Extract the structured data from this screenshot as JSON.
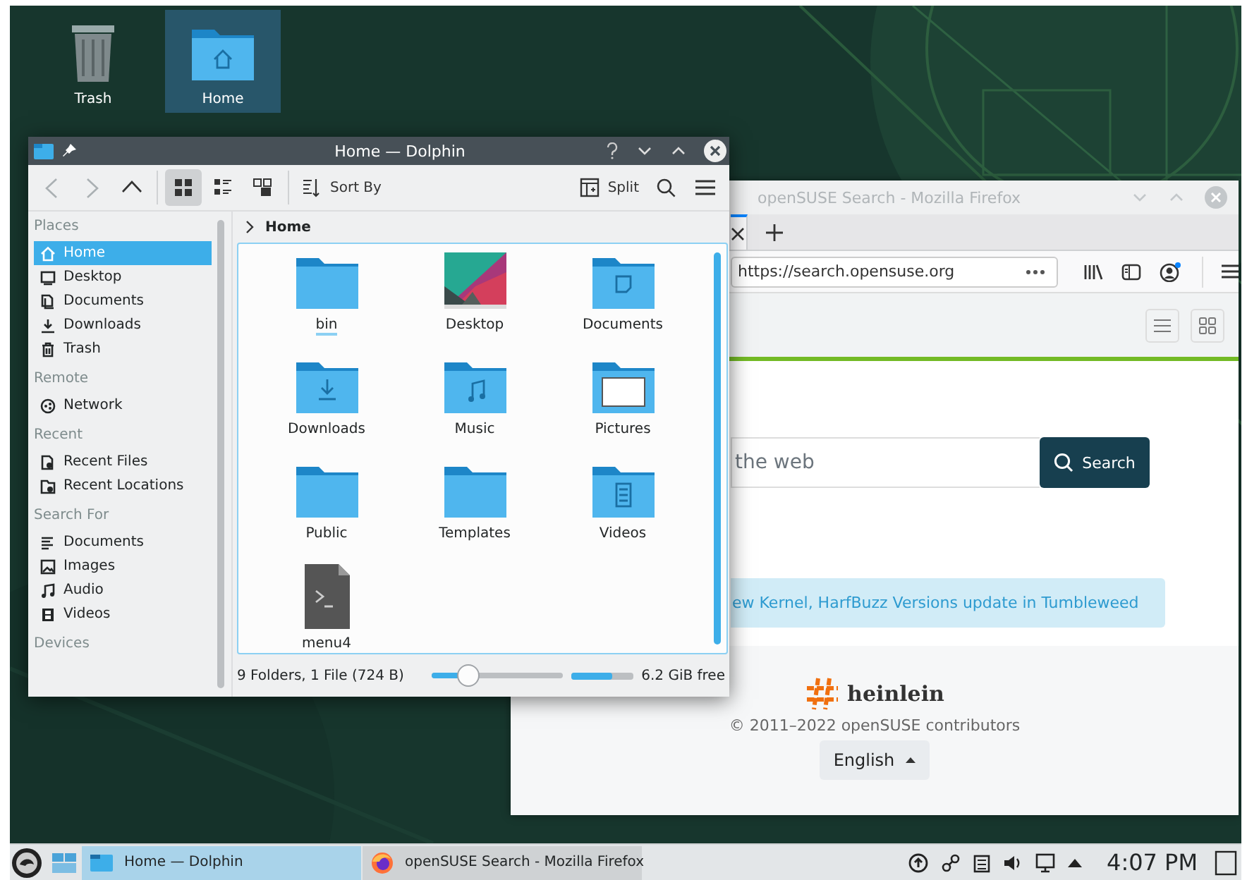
{
  "desktop_icons": [
    {
      "label": "Trash",
      "kind": "trash",
      "selected": false
    },
    {
      "label": "Home",
      "kind": "home",
      "selected": true
    }
  ],
  "dolphin": {
    "title": "Home — Dolphin",
    "active": true,
    "nav": [
      {
        "kind": "back",
        "disabled": true
      },
      {
        "kind": "forward",
        "disabled": true
      },
      {
        "kind": "up",
        "disabled": false
      }
    ],
    "view_modes": [
      {
        "kind": "icons",
        "selected": true
      },
      {
        "kind": "compact",
        "selected": false
      },
      {
        "kind": "details",
        "selected": false
      }
    ],
    "sort_label": "Sort By",
    "split_label": "Split",
    "places": [
      {
        "heading": "Places",
        "items": [
          {
            "label": "Home",
            "kind": "home",
            "selected": true
          },
          {
            "label": "Desktop",
            "kind": "desktop",
            "selected": false
          },
          {
            "label": "Documents",
            "kind": "documents",
            "selected": false
          },
          {
            "label": "Downloads",
            "kind": "downloads",
            "selected": false
          },
          {
            "label": "Trash",
            "kind": "trash",
            "selected": false
          }
        ]
      },
      {
        "heading": "Remote",
        "items": [
          {
            "label": "Network",
            "kind": "network",
            "selected": false
          }
        ]
      },
      {
        "heading": "Recent",
        "items": [
          {
            "label": "Recent Files",
            "kind": "recent-files",
            "selected": false
          },
          {
            "label": "Recent Locations",
            "kind": "recent-locations",
            "selected": false
          }
        ]
      },
      {
        "heading": "Search For",
        "items": [
          {
            "label": "Documents",
            "kind": "text",
            "selected": false
          },
          {
            "label": "Images",
            "kind": "images",
            "selected": false
          },
          {
            "label": "Audio",
            "kind": "audio",
            "selected": false
          },
          {
            "label": "Videos",
            "kind": "videos",
            "selected": false
          }
        ]
      },
      {
        "heading": "Devices"
      }
    ],
    "breadcrumb": "Home",
    "files": [
      {
        "name": "bin",
        "kind": "folder",
        "focused": true
      },
      {
        "name": "Desktop",
        "kind": "thumbnail",
        "focused": false
      },
      {
        "name": "Documents",
        "kind": "documents",
        "focused": false
      },
      {
        "name": "Downloads",
        "kind": "downloads",
        "focused": false
      },
      {
        "name": "Music",
        "kind": "music",
        "focused": false
      },
      {
        "name": "Pictures",
        "kind": "pictures",
        "focused": false
      },
      {
        "name": "Public",
        "kind": "folder",
        "focused": false
      },
      {
        "name": "Templates",
        "kind": "folder",
        "focused": false
      },
      {
        "name": "Videos",
        "kind": "videos",
        "focused": false
      },
      {
        "name": "menu4",
        "kind": "script",
        "focused": false
      }
    ],
    "status": "9 Folders, 1 File (724 B)",
    "zoom": {
      "level": 0.28
    },
    "space": {
      "level": 0.67,
      "text": "6.2 GiB free"
    }
  },
  "firefox": {
    "title": "openSUSE Search - Mozilla Firefox",
    "active": false,
    "url": "https://search.opensuse.org",
    "search_placeholder": "the web",
    "search_button": "Search",
    "news": "ew Kernel, HarfBuzz Versions update in Tumbleweed",
    "brand": "heinlein",
    "copyright": "© 2011–2022 openSUSE contributors",
    "language": "English"
  },
  "taskbar": {
    "tasks": [
      {
        "label": "Home — Dolphin",
        "kind": "dolphin",
        "selected": true
      },
      {
        "label": "openSUSE Search - Mozilla Firefox",
        "kind": "firefox",
        "selected": false
      }
    ],
    "clock": "4:07 PM"
  }
}
